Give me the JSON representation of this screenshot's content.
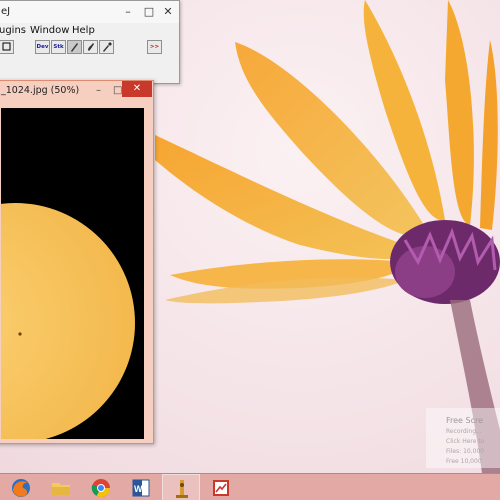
{
  "imagej": {
    "title": "eJ",
    "menus": [
      "ugins",
      "Window",
      "Help"
    ],
    "tools": [
      {
        "icon": "rectangle-select-icon",
        "label": ""
      },
      {
        "icon": "dev-menu-icon",
        "label": "Dev"
      },
      {
        "icon": "stk-menu-icon",
        "label": "Stk"
      },
      {
        "icon": "pen-tool-icon",
        "label": ""
      },
      {
        "icon": "brush-tool-icon",
        "label": ""
      },
      {
        "icon": "eyedropper-tool-icon",
        "label": ""
      },
      {
        "icon": "more-tools-icon",
        "label": ">>"
      }
    ]
  },
  "image_window": {
    "title": "_1024.jpg (50%)"
  },
  "watermark": {
    "title": "Free Scre",
    "lines": [
      "Recording...",
      "Click Here to",
      "Files: 10,000",
      "Free 10,000"
    ]
  },
  "taskbar": {
    "apps": [
      {
        "icon": "firefox-icon",
        "active": false
      },
      {
        "icon": "file-explorer-icon",
        "active": false
      },
      {
        "icon": "chrome-icon",
        "active": false
      },
      {
        "icon": "word-icon",
        "active": false
      },
      {
        "icon": "imagej-icon",
        "active": true
      },
      {
        "icon": "screen-recorder-icon",
        "active": false
      }
    ]
  },
  "colors": {
    "sun": "#f9c866",
    "sun_edge": "#f2b94f",
    "petal": "#f7a531",
    "flower_center": "#6d2a6a",
    "taskbar": "#e2a9a5",
    "close_button": "#c8382b"
  }
}
